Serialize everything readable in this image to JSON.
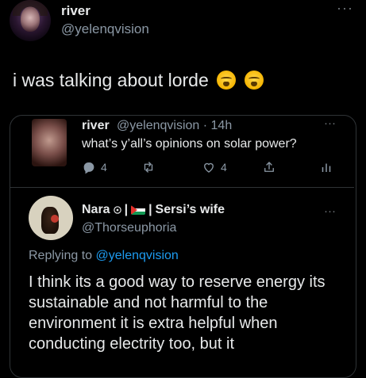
{
  "tweet": {
    "author_name": "river",
    "author_handle": "@yelenqvision",
    "text": "i was talking about lorde",
    "more_label": "···"
  },
  "quoted": {
    "author_name": "river",
    "author_handle": "@yelenqvision",
    "time": "· 14h",
    "text": "what’s y’all’s opinions on solar power?",
    "more_label": "···",
    "actions": {
      "reply_count": "4",
      "retweet_count": "",
      "like_count": "4"
    },
    "reply": {
      "author_name": "Nara",
      "name_suffix": "Sersi’s wife",
      "author_handle": "@Thorseuphoria",
      "more_label": "···",
      "replying_prefix": "Replying to ",
      "replying_to": "@yelenqvision",
      "text": "I think its a good way to reserve energy its sustainable and not harmful to the environment it is extra helpful when conducting electrity too, but it"
    }
  },
  "colors": {
    "background": "#000000",
    "text": "#e7e9ea",
    "muted": "#8b98a5",
    "link": "#1d9bf0",
    "border": "#2f3336"
  }
}
